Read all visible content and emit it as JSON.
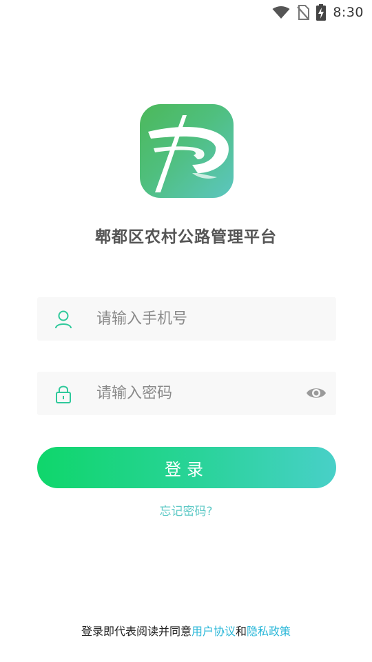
{
  "status_bar": {
    "time": "8:30",
    "icons": [
      "wifi-icon",
      "no-sim-icon",
      "battery-charging-icon"
    ]
  },
  "app": {
    "logo_icon": "road-curve-logo",
    "title": "郫都区农村公路管理平台"
  },
  "form": {
    "phone": {
      "placeholder": "请输入手机号",
      "value": "",
      "icon": "user-icon"
    },
    "password": {
      "placeholder": "请输入密码",
      "value": "",
      "icon": "lock-icon",
      "toggle_icon": "eye-icon"
    },
    "login_label": "登录",
    "forgot_label": "忘记密码?"
  },
  "agreement": {
    "prefix": "登录即代表阅读并同意",
    "user_agreement": "用户协议",
    "conjunction": "和",
    "privacy_policy": "隐私政策"
  },
  "colors": {
    "accent_green": "#0fd66b",
    "accent_teal": "#48d0c8",
    "field_bg": "#f8f8f8",
    "link_blue": "#2ab7d8",
    "icon_green": "#2ec99a"
  }
}
